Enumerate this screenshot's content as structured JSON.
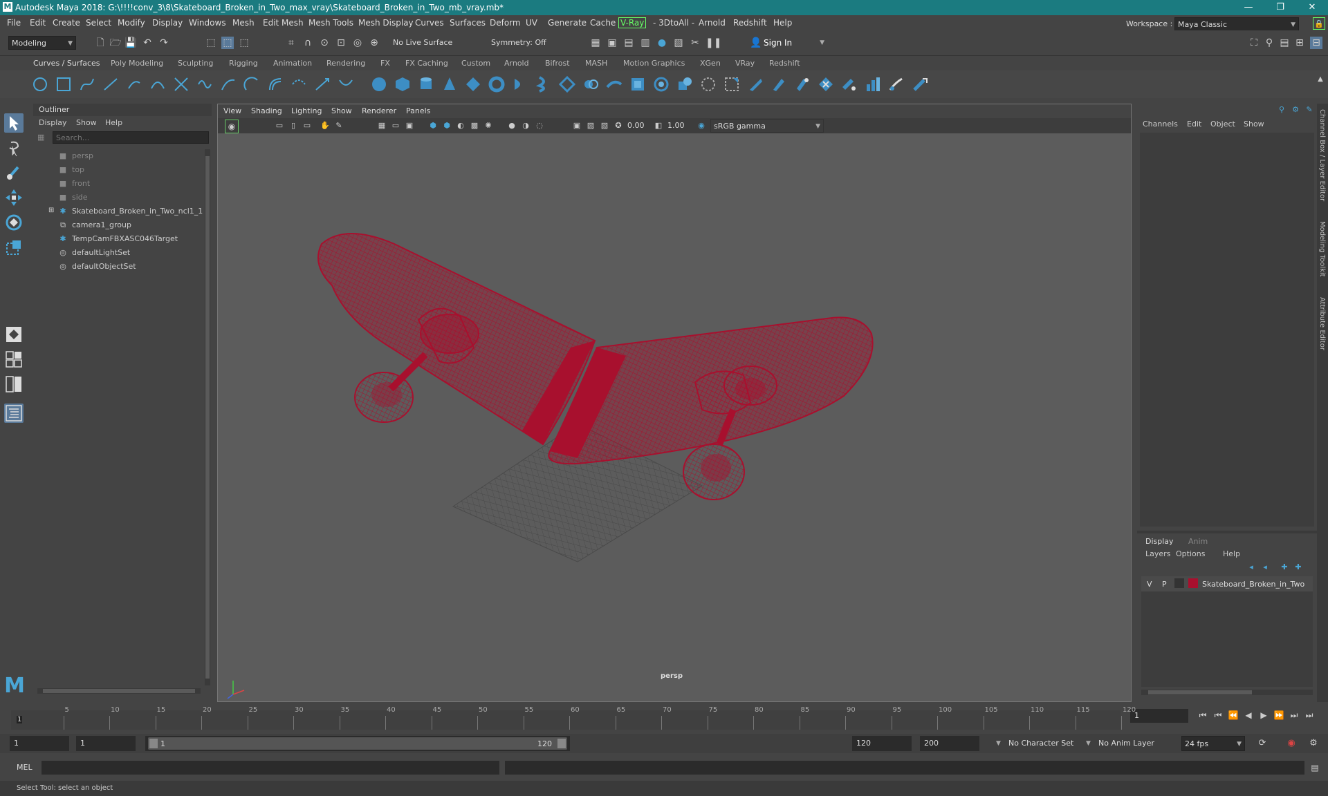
{
  "window": {
    "title": "Autodesk Maya 2018: G:\\!!!!conv_3\\8\\Skateboard_Broken_in_Two_max_vray\\Skateboard_Broken_in_Two_mb_vray.mb*",
    "workspace_label": "Workspace :",
    "workspace_value": "Maya Classic"
  },
  "menu": [
    "File",
    "Edit",
    "Create",
    "Select",
    "Modify",
    "Display",
    "Windows",
    "Mesh",
    "Edit Mesh",
    "Mesh Tools",
    "Mesh Display",
    "Curves",
    "Surfaces",
    "Deform",
    "UV",
    "Generate",
    "Cache",
    "V-Ray",
    "- 3DtoAll -",
    "Arnold",
    "Redshift",
    "Help"
  ],
  "toolbar": {
    "mode": "Modeling",
    "live_surface": "No Live Surface",
    "symmetry": "Symmetry: Off",
    "sign_in": "Sign In"
  },
  "shelf_tabs": [
    "Curves / Surfaces",
    "Poly Modeling",
    "Sculpting",
    "Rigging",
    "Animation",
    "Rendering",
    "FX",
    "FX Caching",
    "Custom",
    "Arnold",
    "Bifrost",
    "MASH",
    "Motion Graphics",
    "XGen",
    "VRay",
    "Redshift"
  ],
  "outliner": {
    "title": "Outliner",
    "menu": [
      "Display",
      "Show",
      "Help"
    ],
    "search_placeholder": "Search...",
    "items": [
      "persp",
      "top",
      "front",
      "side",
      "Skateboard_Broken_in_Two_ncl1_1",
      "camera1_group",
      "TempCamFBXASC046Target",
      "defaultLightSet",
      "defaultObjectSet"
    ]
  },
  "viewport": {
    "menu": [
      "View",
      "Shading",
      "Lighting",
      "Show",
      "Renderer",
      "Panels"
    ],
    "exposure": "0.00",
    "gamma": "1.00",
    "color_space": "sRGB gamma",
    "camera_label": "persp"
  },
  "channel_box": {
    "menu": [
      "Channels",
      "Edit",
      "Object",
      "Show"
    ],
    "side_tabs": [
      "Channel Box / Layer Editor",
      "Modeling Toolkit",
      "Attribute Editor"
    ]
  },
  "layer_editor": {
    "tabs": [
      "Display",
      "Anim"
    ],
    "menu": [
      "Layers",
      "Options",
      "Help"
    ],
    "layer": {
      "v": "V",
      "p": "P",
      "name": "Skateboard_Broken_in_Two",
      "color": "#a8102e"
    }
  },
  "timeline": {
    "ticks": [
      "5",
      "10",
      "15",
      "20",
      "25",
      "30",
      "35",
      "40",
      "45",
      "50",
      "55",
      "60",
      "65",
      "70",
      "75",
      "80",
      "85",
      "90",
      "95",
      "100",
      "105",
      "110",
      "115",
      "120"
    ],
    "current_frame_marker": "1",
    "current_frame": "1"
  },
  "range": {
    "start": "1",
    "playback_start": "1",
    "slider_start": "1",
    "slider_end": "120",
    "playback_end": "120",
    "end": "200",
    "character_set": "No Character Set",
    "anim_layer": "No Anim Layer",
    "fps": "24 fps"
  },
  "command": {
    "label": "MEL"
  },
  "status": {
    "text": "Select Tool: select an object"
  },
  "colors": {
    "accent": "#1b7b80",
    "wire": "#a8102e",
    "icon_blue": "#4aa6d6"
  }
}
